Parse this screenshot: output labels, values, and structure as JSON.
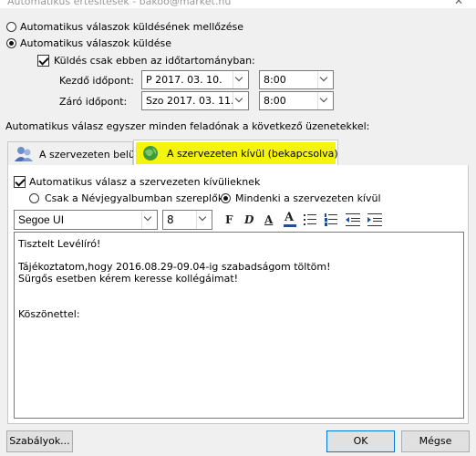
{
  "window": {
    "title": "Automatikus értesítések - bakoo@market.hu",
    "close_symbol": "✕"
  },
  "radio_off": {
    "label": "Automatikus válaszok küldésének mellőzése",
    "checked": false
  },
  "radio_on": {
    "label": "Automatikus válaszok küldése",
    "checked": true
  },
  "time_range": {
    "label": "Küldés csak ebben az időtartományban:",
    "checked": true,
    "start_label": "Kezdő időpont:",
    "start_date": "P 2017. 03. 10.",
    "start_time": "8:00",
    "end_label": "Záró időpont:",
    "end_date": "Szo 2017. 03. 11.",
    "end_time": "8:00"
  },
  "section_text": "Automatikus válasz egyszer minden feladónak a következő üzenetekkel:",
  "tabs": [
    {
      "label": "A szervezeten belül",
      "icon": "people-icon",
      "active": false
    },
    {
      "label": "A szervezeten kívül (bekapcsolva)",
      "icon": "globe-icon",
      "active": true,
      "highlight": "#f4f40c"
    }
  ],
  "outside": {
    "auto_reply_label": "Automatikus válasz a szervezeten kívülieknek",
    "auto_reply_checked": true,
    "contacts_only_label": "Csak a Névjegyalbumban szereplők",
    "everyone_label": "Mindenki a szervezeten kívül",
    "everyone_selected": true
  },
  "format": {
    "font": "Segoe UI",
    "size": "8",
    "bold": "F",
    "italic": "D",
    "underline": "A",
    "font_color": "A"
  },
  "message": {
    "line1": "Tisztelt Levélíró!",
    "line2": "Tájékoztatom,hogy 2016.08.29-09.04-ig szabadságom töltöm!",
    "line3": "Sürgős esetben kérem keresse kollégáimat!",
    "line4": "Köszönettel:"
  },
  "buttons": {
    "rules": "Szabályok...",
    "ok": "OK",
    "cancel": "Mégse"
  }
}
